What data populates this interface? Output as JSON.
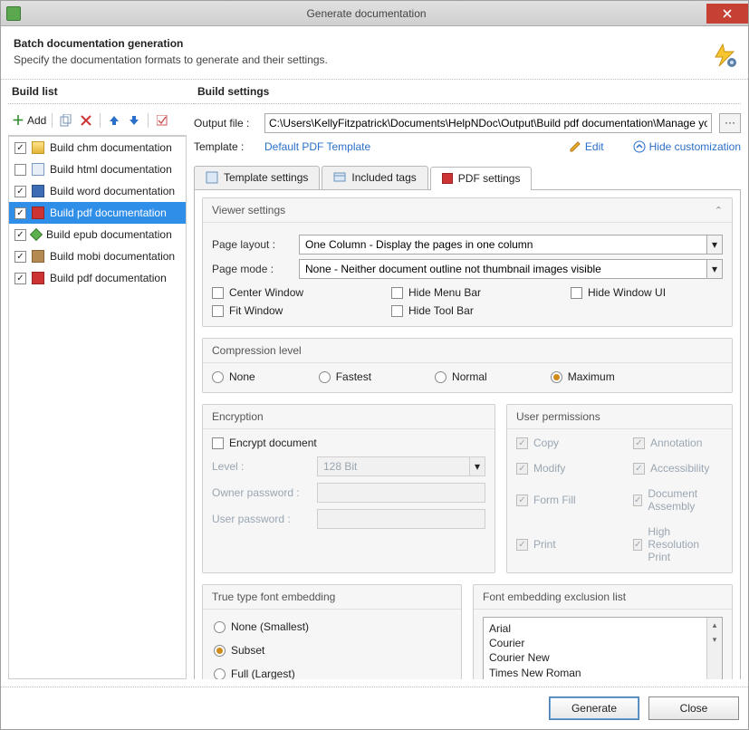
{
  "title": "Generate documentation",
  "header": {
    "h1": "Batch documentation generation",
    "sub": "Specify the documentation formats to generate and their settings."
  },
  "buildList": {
    "title": "Build list",
    "addLabel": "Add",
    "items": [
      {
        "label": "Build chm documentation",
        "checked": true,
        "icon": "chm"
      },
      {
        "label": "Build html documentation",
        "checked": false,
        "icon": "html"
      },
      {
        "label": "Build word documentation",
        "checked": true,
        "icon": "word"
      },
      {
        "label": "Build pdf documentation",
        "checked": true,
        "icon": "pdf",
        "selected": true
      },
      {
        "label": "Build epub documentation",
        "checked": true,
        "icon": "epub"
      },
      {
        "label": "Build mobi documentation",
        "checked": true,
        "icon": "mobi"
      },
      {
        "label": "Build pdf documentation",
        "checked": true,
        "icon": "pdf"
      }
    ]
  },
  "settings": {
    "title": "Build settings",
    "outputLabel": "Output file :",
    "outputValue": "C:\\Users\\KellyFitzpatrick\\Documents\\HelpNDoc\\Output\\Build pdf documentation\\Manage your Table of C",
    "templateLabel": "Template :",
    "templateName": "Default PDF Template",
    "editLabel": "Edit",
    "hideCustLabel": "Hide customization",
    "tabs": {
      "template": "Template settings",
      "tags": "Included tags",
      "pdf": "PDF settings"
    },
    "viewer": {
      "title": "Viewer settings",
      "pageLayoutLabel": "Page layout :",
      "pageLayoutValue": "One Column - Display the pages in one column",
      "pageModeLabel": "Page mode :",
      "pageModeValue": "None - Neither document outline not thumbnail images visible",
      "checks": {
        "centerWindow": "Center Window",
        "hideMenuBar": "Hide Menu Bar",
        "hideWindowUI": "Hide Window UI",
        "fitWindow": "Fit Window",
        "hideToolBar": "Hide Tool Bar"
      }
    },
    "compression": {
      "title": "Compression level",
      "none": "None",
      "fastest": "Fastest",
      "normal": "Normal",
      "maximum": "Maximum",
      "selected": "maximum"
    },
    "encryption": {
      "title": "Encryption",
      "encryptLabel": "Encrypt document",
      "levelLabel": "Level :",
      "levelValue": "128 Bit",
      "ownerLabel": "Owner password :",
      "userLabel": "User password :"
    },
    "permissions": {
      "title": "User permissions",
      "copy": "Copy",
      "annotation": "Annotation",
      "modify": "Modify",
      "accessibility": "Accessibility",
      "formFill": "Form Fill",
      "docAssembly": "Document Assembly",
      "print": "Print",
      "highRes": "High Resolution Print"
    },
    "fontEmbed": {
      "title": "True type font embedding",
      "none": "None (Smallest)",
      "subset": "Subset",
      "full": "Full (Largest)",
      "selected": "subset"
    },
    "fontExclusion": {
      "title": "Font embedding exclusion list",
      "items": [
        "Arial",
        "Courier",
        "Courier New",
        "Times New Roman"
      ]
    }
  },
  "footer": {
    "generate": "Generate",
    "close": "Close"
  }
}
